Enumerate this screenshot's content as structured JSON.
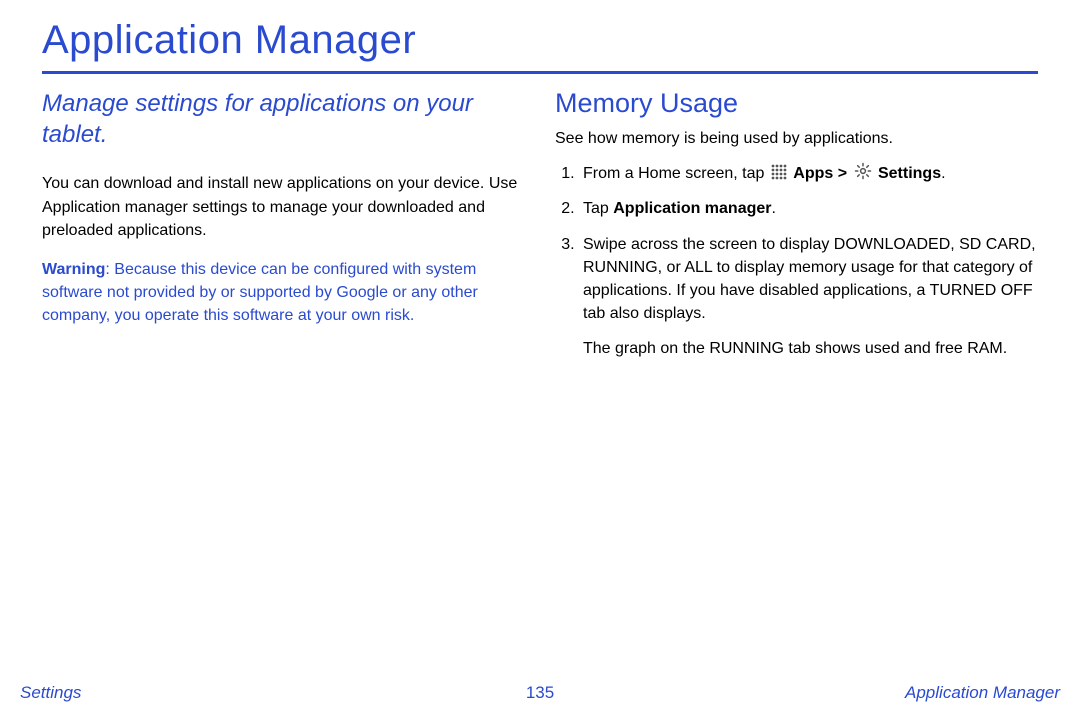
{
  "page": {
    "title": "Application Manager",
    "subtitle": "Manage settings for applications on your tablet.",
    "intro_paragraph": "You can download and install new applications on your device. Use Application manager settings to manage your downloaded and preloaded applications.",
    "warning_label": "Warning",
    "warning_text": ": Because this device can be configured with system software not provided by or supported by Google or any other company, you operate this software at your own risk."
  },
  "memory": {
    "heading": "Memory Usage",
    "intro": "See how memory is being used by applications.",
    "step1_prefix": "From a Home screen, tap ",
    "step1_apps": "Apps",
    "step1_sep": " > ",
    "step1_settings": "Settings",
    "step1_suffix": ".",
    "step2_prefix": "Tap ",
    "step2_bold": "Application manager",
    "step2_suffix": ".",
    "step3": "Swipe across the screen to display DOWNLOADED, SD CARD, RUNNING, or ALL to display memory usage for that category of applications. If you have disabled applications, a TURNED OFF tab also displays.",
    "after": "The graph on the RUNNING tab shows used and free RAM."
  },
  "footer": {
    "left": "Settings",
    "center": "135",
    "right": "Application Manager"
  }
}
